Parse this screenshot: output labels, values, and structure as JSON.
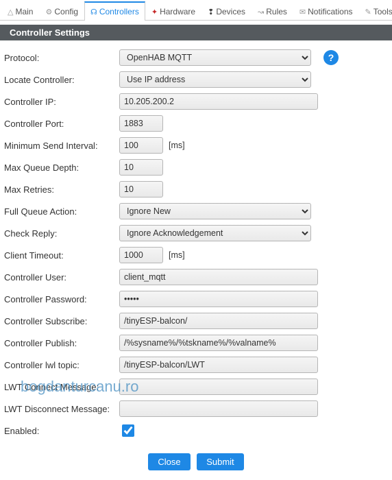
{
  "tabs": {
    "main": {
      "icon": "△",
      "label": "Main"
    },
    "config": {
      "icon": "⚙",
      "label": "Config"
    },
    "controllers": {
      "icon": "☊",
      "label": "Controllers"
    },
    "hardware": {
      "icon": "✦",
      "label": "Hardware"
    },
    "devices": {
      "icon": "❢",
      "label": "Devices"
    },
    "rules": {
      "icon": "↝",
      "label": "Rules"
    },
    "notifications": {
      "icon": "✉",
      "label": "Notifications"
    },
    "tools": {
      "icon": "✎",
      "label": "Tools"
    }
  },
  "section_title": "Controller Settings",
  "labels": {
    "protocol": "Protocol:",
    "locate": "Locate Controller:",
    "ip": "Controller IP:",
    "port": "Controller Port:",
    "min_send": "Minimum Send Interval:",
    "max_queue": "Max Queue Depth:",
    "max_retries": "Max Retries:",
    "full_queue": "Full Queue Action:",
    "check_reply": "Check Reply:",
    "client_timeout": "Client Timeout:",
    "user": "Controller User:",
    "password": "Controller Password:",
    "subscribe": "Controller Subscribe:",
    "publish": "Controller Publish:",
    "lwl_topic": "Controller lwl topic:",
    "lwt_connect": "LWT Connect Message:",
    "lwt_disconnect": "LWT Disconnect Message:",
    "enabled": "Enabled:"
  },
  "values": {
    "protocol": "OpenHAB MQTT",
    "locate": "Use IP address",
    "ip": "10.205.200.2",
    "port": "1883",
    "min_send": "100",
    "max_queue": "10",
    "max_retries": "10",
    "full_queue": "Ignore New",
    "check_reply": "Ignore Acknowledgement",
    "client_timeout": "1000",
    "user": "client_mqtt",
    "password": "•••••",
    "subscribe": "/tinyESP-balcon/",
    "publish": "/%sysname%/%tskname%/%valname%",
    "lwl_topic": "/tinyESP-balcon/LWT",
    "lwt_connect": "",
    "lwt_disconnect": "",
    "enabled": true,
    "unit_ms": "[ms]"
  },
  "help_badge": "?",
  "buttons": {
    "close": "Close",
    "submit": "Submit"
  },
  "watermark": "bogdanturcanu.ro"
}
